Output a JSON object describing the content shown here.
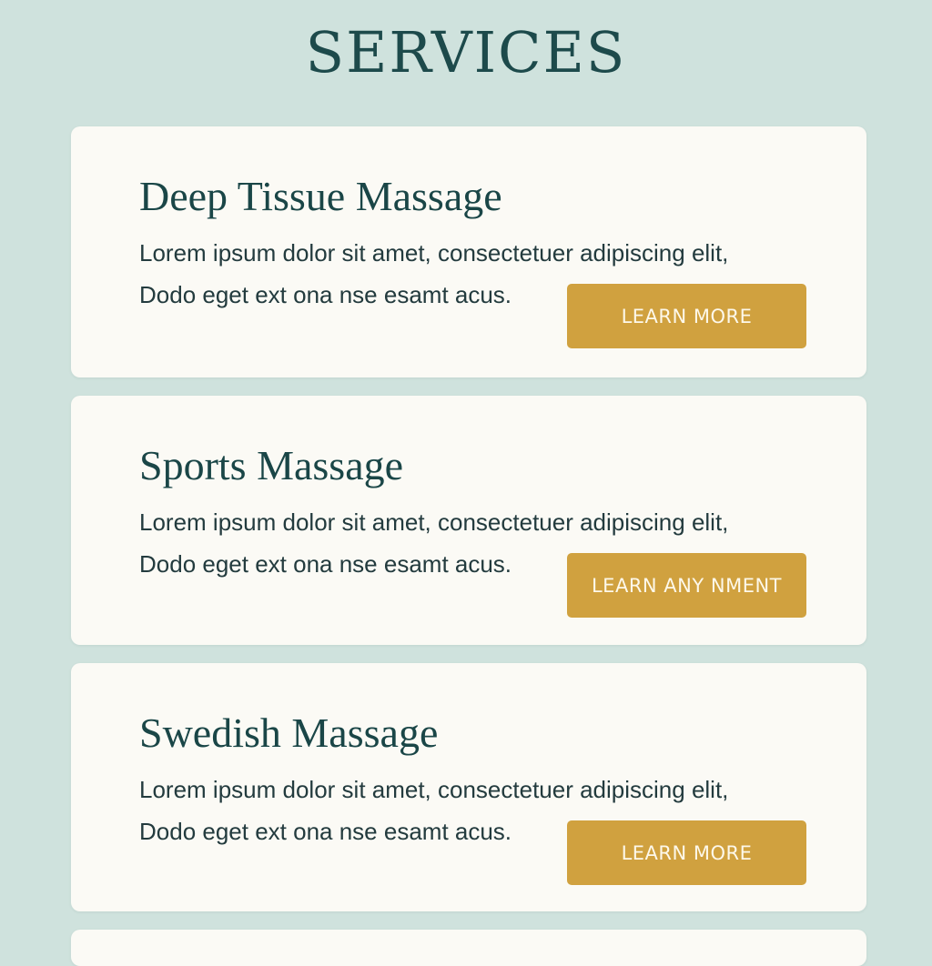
{
  "page": {
    "title": "SERVICES"
  },
  "services": [
    {
      "name": "Deep Tissue Massage",
      "description_line1": "Lorem ipsum dolor sit amet,  consectetuer adipiscing elit,",
      "description_line2": "Dodo eget ext ona nse esamt acus.",
      "button_label": "LEARN MORE"
    },
    {
      "name": "Sports Massage",
      "description_line1": "Lorem ipsum dolor sit amet,  consectetuer adipiscing elit,",
      "description_line2": "Dodo eget ext ona nse esamt acus.",
      "button_label": "LEARN ANY NMENT"
    },
    {
      "name": "Swedish Massage",
      "description_line1": "Lorem ipsum dolor sit amet,  consectetuer adipiscing elit,",
      "description_line2": "Dodo eget ext ona nse esamt acus.",
      "button_label": "LEARN MORE"
    }
  ],
  "colors": {
    "background": "#cfe2dd",
    "card": "#fbfaf5",
    "heading": "#1d4a4b",
    "button": "#d0a13f",
    "button_text": "#fdf8ea"
  }
}
